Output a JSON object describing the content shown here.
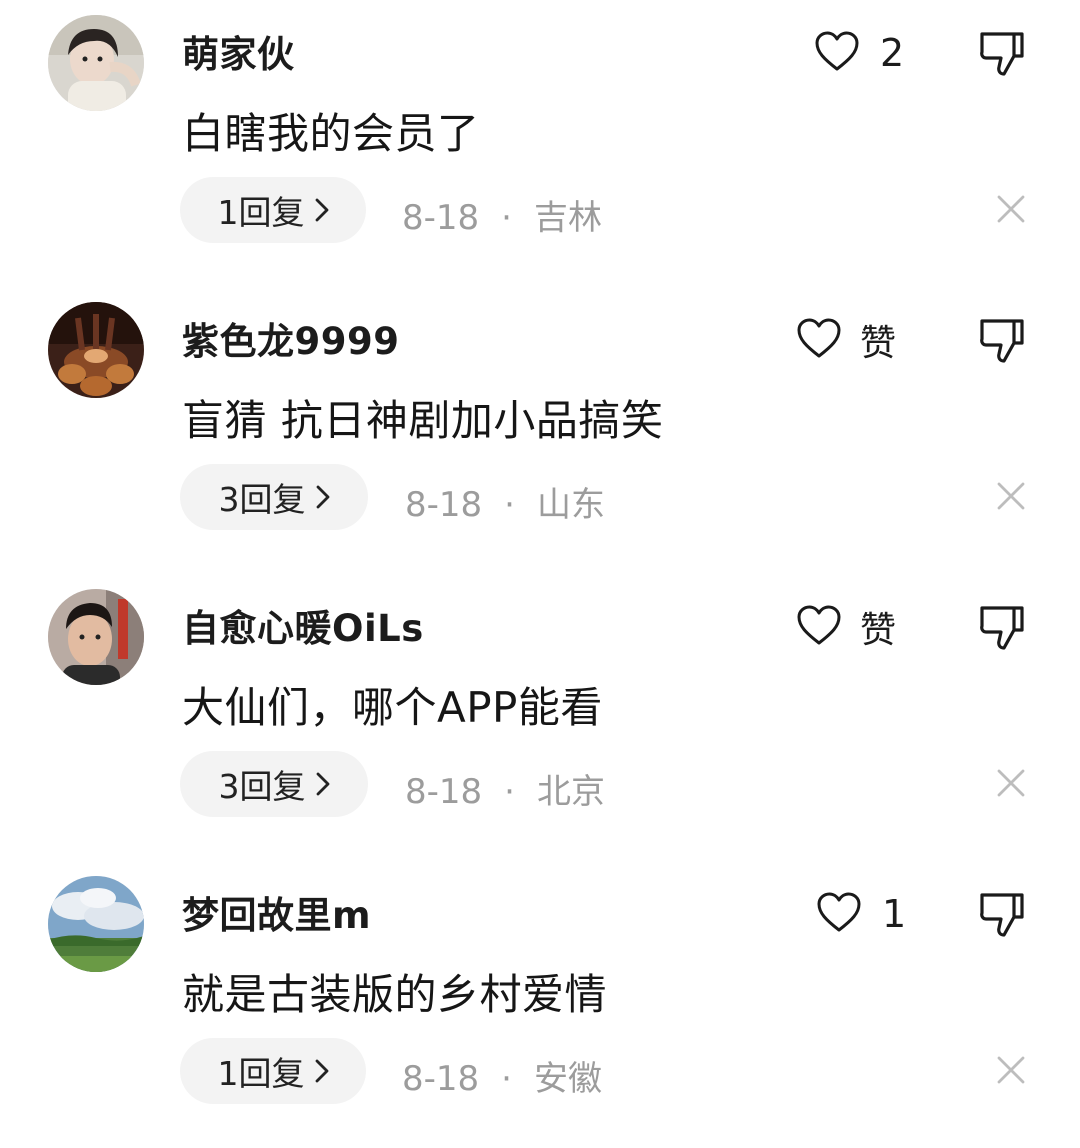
{
  "comments": [
    {
      "username": "萌家伙",
      "content": "白瞎我的会员了",
      "reply_label": "1回复",
      "date": "8-18",
      "separator": "·",
      "location": "吉林",
      "like_text": "2",
      "avatar_icon": "person-selfie-avatar"
    },
    {
      "username": "紫色龙9999",
      "content": "盲猜 抗日神剧加小品搞笑",
      "reply_label": "3回复",
      "date": "8-18",
      "separator": "·",
      "location": "山东",
      "like_text": "赞",
      "avatar_icon": "chocolate-food-avatar"
    },
    {
      "username": "自愈心暖OiLs",
      "content": "大仙们，哪个APP能看",
      "reply_label": "3回复",
      "date": "8-18",
      "separator": "·",
      "location": "北京",
      "like_text": "赞",
      "avatar_icon": "man-portrait-avatar"
    },
    {
      "username": "梦回故里m",
      "content": "就是古装版的乡村爱情",
      "reply_label": "1回复",
      "date": "8-18",
      "separator": "·",
      "location": "安徽",
      "like_text": "1",
      "avatar_icon": "landscape-sky-avatar"
    }
  ],
  "icons": {
    "like": "heart-outline-icon",
    "dislike": "thumbs-down-outline-icon",
    "close": "close-x-icon",
    "chevron": "chevron-right-icon"
  },
  "colors": {
    "text_primary": "#161616",
    "text_secondary": "#9c9c9c",
    "pill_bg": "#f3f3f3",
    "icon_stroke": "#1a1a1a",
    "close_stroke": "#bdbdbd"
  }
}
